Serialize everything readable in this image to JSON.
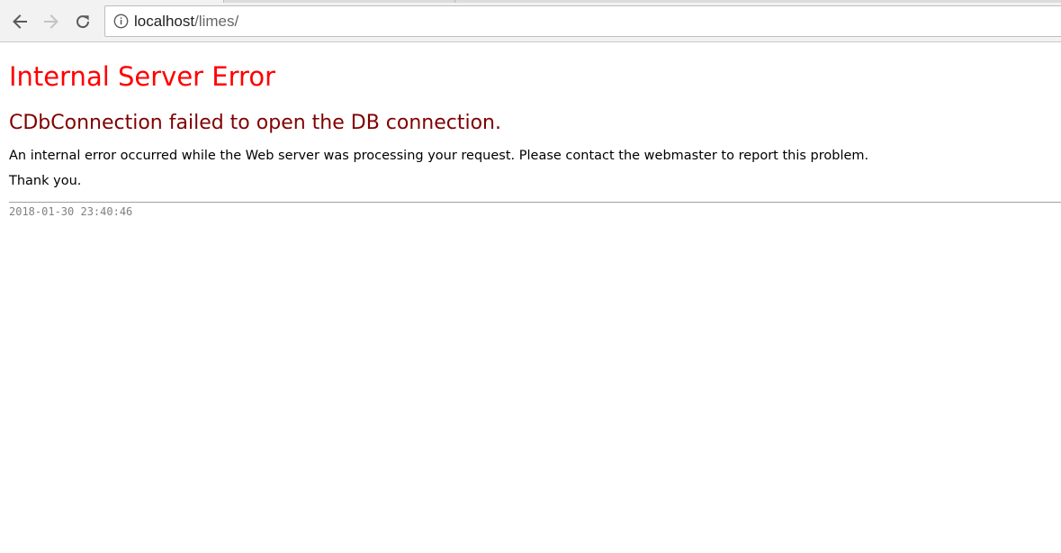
{
  "browser": {
    "address_bar": {
      "host": "localhost",
      "path": "/limes/"
    },
    "icons": {
      "back": "arrow-left-icon",
      "forward": "arrow-right-icon",
      "reload": "reload-icon",
      "site_info": "info-icon"
    },
    "forward_enabled": false
  },
  "page": {
    "title": "Internal Server Error",
    "message": "CDbConnection failed to open the DB connection.",
    "body": "An internal error occurred while the Web server was processing your request. Please contact the webmaster to report this problem.",
    "thanks": "Thank you.",
    "timestamp": "2018-01-30 23:40:46"
  },
  "colors": {
    "title": "#ff0000",
    "message": "#800000",
    "timestamp": "#808080"
  }
}
